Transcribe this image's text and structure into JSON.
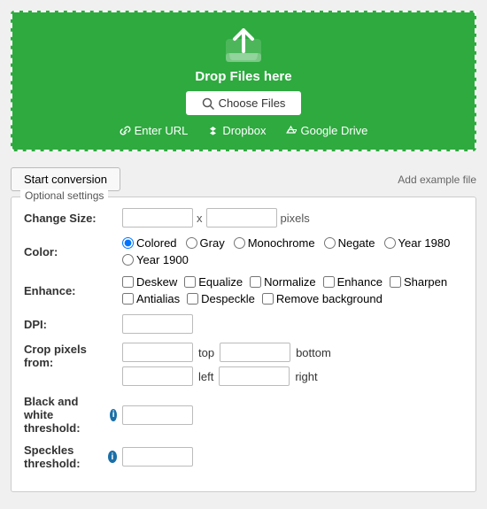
{
  "upload": {
    "drop_text": "Drop Files here",
    "choose_label": "Choose Files",
    "enter_url": "Enter URL",
    "dropbox": "Dropbox",
    "google_drive": "Google Drive"
  },
  "toolbar": {
    "start_label": "Start conversion",
    "add_example": "Add example file"
  },
  "settings": {
    "legend": "Optional settings",
    "change_size_label": "Change Size:",
    "x_sep": "x",
    "pixels_label": "pixels",
    "color_label": "Color:",
    "color_options": [
      "Colored",
      "Gray",
      "Monochrome",
      "Negate",
      "Year 1980",
      "Year 1900"
    ],
    "enhance_label": "Enhance:",
    "enhance_options": [
      "Deskew",
      "Equalize",
      "Normalize",
      "Enhance",
      "Sharpen",
      "Antialias",
      "Despeckle",
      "Remove background"
    ],
    "dpi_label": "DPI:",
    "crop_label": "Crop pixels from:",
    "top_label": "top",
    "bottom_label": "bottom",
    "left_label": "left",
    "right_label": "right",
    "bw_label": "Black and white threshold:",
    "speckles_label": "Speckles threshold:"
  },
  "colors": {
    "green": "#2eaa3f",
    "info_blue": "#1a6fa8"
  }
}
